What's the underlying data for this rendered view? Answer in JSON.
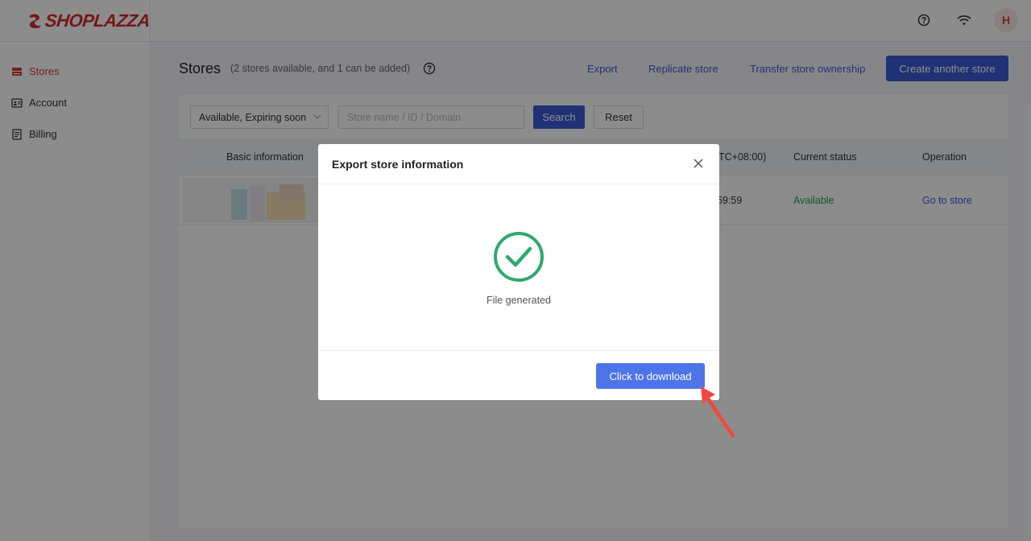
{
  "brand": {
    "name": "SHOPLAZZA",
    "color": "#d42a2a"
  },
  "topbar": {
    "help_icon": "question-circle-icon",
    "wifi_icon": "wifi-icon",
    "avatar_initial": "H"
  },
  "sidebar": {
    "items": [
      {
        "label": "Stores",
        "icon": "store-icon",
        "active": true
      },
      {
        "label": "Account",
        "icon": "id-card-icon",
        "active": false
      },
      {
        "label": "Billing",
        "icon": "document-icon",
        "active": false
      }
    ]
  },
  "page": {
    "title": "Stores",
    "subtitle": "(2 stores available, and 1 can be added)",
    "actions": {
      "export": "Export",
      "replicate": "Replicate store",
      "transfer": "Transfer store ownership",
      "create": "Create another store"
    }
  },
  "filters": {
    "status_select": "Available, Expiring soon",
    "search_placeholder": "Store name / ID / Domain",
    "search_label": "Search",
    "reset_label": "Reset"
  },
  "table": {
    "headers": {
      "basic": "Basic information",
      "expiry": "TC+08:00)",
      "status": "Current status",
      "operation": "Operation"
    },
    "rows": [
      {
        "expiry": "59:59",
        "status": "Available",
        "operation": "Go to store"
      }
    ]
  },
  "modal": {
    "title": "Export store information",
    "message": "File generated",
    "button": "Click to download"
  },
  "colors": {
    "accent": "#3b5bd6",
    "success": "#2eaa6f",
    "available": "#2e9d58",
    "arrow": "#f0483e"
  }
}
